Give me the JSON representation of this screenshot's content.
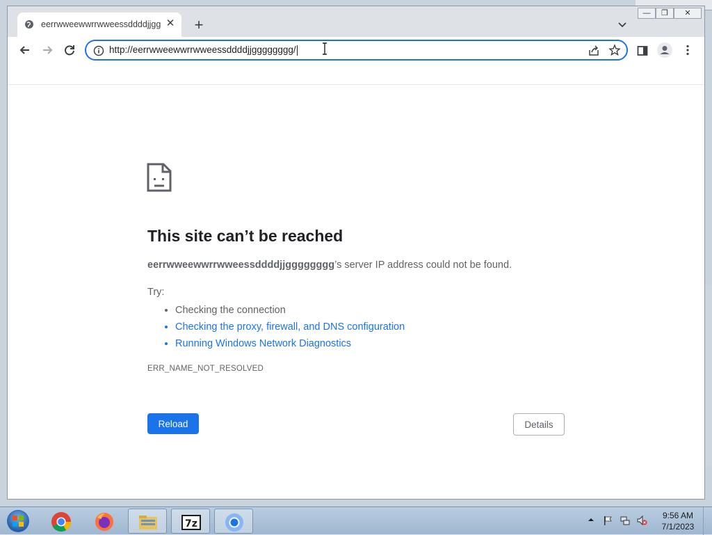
{
  "browser": {
    "tab": {
      "title": "eerrwweewwrrwweessddddjjgggg",
      "close_label": "✕"
    },
    "new_tab_label": "+",
    "window_controls": {
      "minimize": "—",
      "restore": "❐",
      "close": "✕"
    },
    "address_bar": {
      "url": "http://eerrwweewwrrwweessddddjjgggggggg/"
    }
  },
  "error_page": {
    "title": "This site can’t be reached",
    "host": "eerrwweewwrrwweessddddjjgggggggg",
    "message_suffix": "’s server IP address could not be found.",
    "try_label": "Try:",
    "suggestions": [
      {
        "text": "Checking the connection"
      },
      {
        "text": "Checking the proxy, firewall, and DNS configuration"
      },
      {
        "text": "Running Windows Network Diagnostics"
      }
    ],
    "error_code": "ERR_NAME_NOT_RESOLVED",
    "reload_label": "Reload",
    "details_label": "Details"
  },
  "taskbar": {
    "items": [
      "chrome",
      "firefox",
      "file-explorer",
      "7zip",
      "chromium"
    ],
    "clock": {
      "time": "9:56 AM",
      "date": "7/1/2023"
    }
  },
  "colors": {
    "accent": "#1a73e8",
    "text_primary": "#202124",
    "text_secondary": "#5f6368"
  },
  "icons": [
    "globe-icon",
    "back-arrow-icon",
    "forward-arrow-icon",
    "reload-icon",
    "info-icon",
    "share-icon",
    "star-icon",
    "side-panel-icon",
    "profile-icon",
    "menu-icon",
    "sad-page-icon"
  ]
}
